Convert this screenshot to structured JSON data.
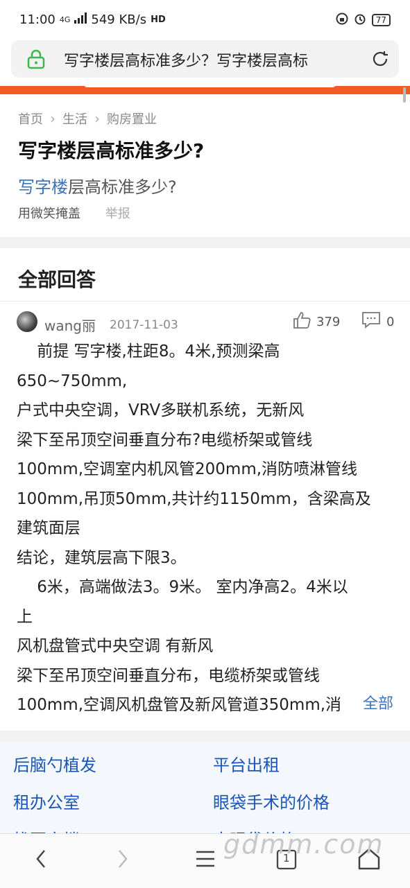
{
  "status": {
    "time": "11:00",
    "network": "4G",
    "speed": "549 KB/s",
    "hd": "HD",
    "battery": "77"
  },
  "urlbar": {
    "text": "写字楼层高标准多少？写字楼层高标"
  },
  "breadcrumb": {
    "items": [
      "首页",
      "生活",
      "购房置业"
    ]
  },
  "question": {
    "title": "写字楼层高标准多少?",
    "subtitle_link": "写字楼",
    "subtitle_rest": "层高标准多少?",
    "asker": "用微笑掩盖",
    "report": "举报"
  },
  "answers": {
    "heading": "全部回答",
    "first": {
      "author": "wang丽",
      "date": "2017-11-03",
      "likes": "379",
      "comments": "0",
      "lines": [
        "    前提 写字楼,柱距8。4米,预测梁高",
        "650~750mm,",
        "户式中央空调，VRV多联机系统，无新风",
        "梁下至吊顶空间垂直分布?电缆桥架或管线",
        "100mm,空调室内机风管200mm,消防喷淋管线",
        "100mm,吊顶50mm,共计约1150mm，含梁高及",
        "建筑面层",
        "结论，建筑层高下限3。",
        "    6米，高端做法3。9米。 室内净高2。4米以",
        "上",
        "风机盘管式中央空调 有新风",
        "梁下至吊顶空间垂直分布，电缆桥架或管线",
        "100mm,空调风机盘管及新风管道350mm,消"
      ],
      "more": "全部"
    }
  },
  "related": {
    "items": [
      "后脑勺植发",
      "平台出租",
      "租办公室",
      "眼袋手术的价格",
      "找写字楼",
      "大眼袋价格"
    ]
  },
  "nav": {
    "tabs_count": "1"
  },
  "watermark": "gdmm.com"
}
